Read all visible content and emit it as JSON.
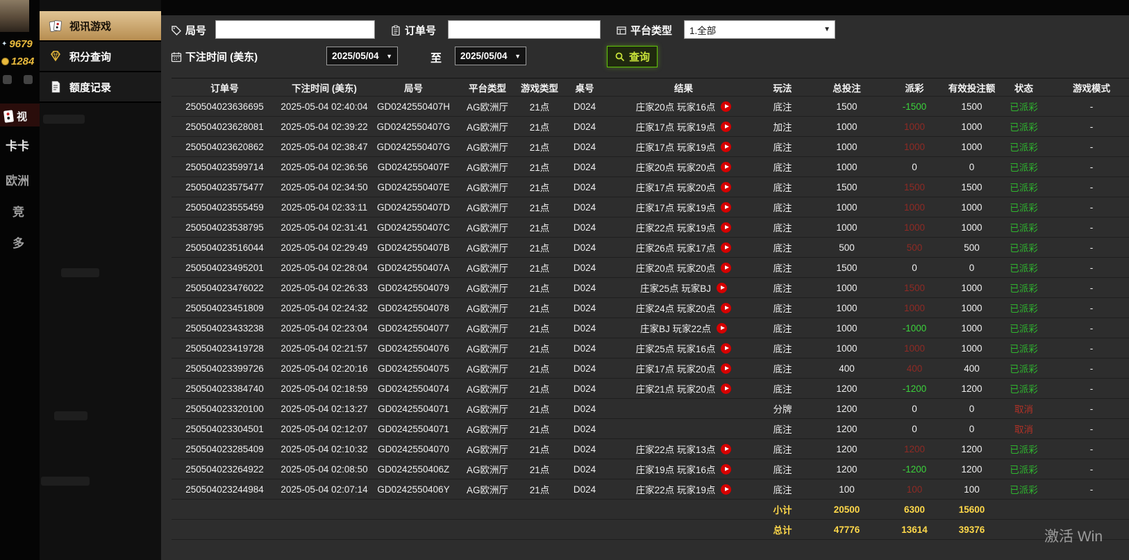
{
  "underlay": {
    "balance_points": "9679",
    "balance_credits": "1284",
    "menu_video": "视",
    "menu_kaka": "卡卡",
    "menu_europe": "欧洲",
    "menu_jing": "竞",
    "menu_duo": "多"
  },
  "sidebar": {
    "items": [
      {
        "label": "视讯游戏"
      },
      {
        "label": "积分查询"
      },
      {
        "label": "额度记录"
      }
    ]
  },
  "filters": {
    "round_label": "局号",
    "round_value": "",
    "order_label": "订单号",
    "order_value": "",
    "platform_label": "平台类型",
    "platform_value": "1.全部",
    "bet_time_label": "下注时间 (美东)",
    "date_from": "2025/05/04",
    "to_label": "至",
    "date_to": "2025/05/04",
    "search_label": "查询"
  },
  "table": {
    "headers": [
      "订单号",
      "下注时间 (美东)",
      "局号",
      "平台类型",
      "游戏类型",
      "桌号",
      "结果",
      "玩法",
      "总投注",
      "派彩",
      "有效投注额",
      "状态",
      "游戏模式"
    ],
    "rows": [
      {
        "order": "250504023636695",
        "time": "2025-05-04 02:40:04",
        "round": "GD0242550407H",
        "platform": "AG欧洲厅",
        "game": "21点",
        "table_no": "D024",
        "result": "庄家20点 玩家16点",
        "has_play": true,
        "play": "底注",
        "bet": "1500",
        "payout": "-1500",
        "payout_type": "neg",
        "valid": "1500",
        "status": "已派彩",
        "status_type": "paid",
        "mode": "-"
      },
      {
        "order": "250504023628081",
        "time": "2025-05-04 02:39:22",
        "round": "GD0242550407G",
        "platform": "AG欧洲厅",
        "game": "21点",
        "table_no": "D024",
        "result": "庄家17点 玩家19点",
        "has_play": true,
        "play": "加注",
        "bet": "1000",
        "payout": "1000",
        "payout_type": "pos",
        "valid": "1000",
        "status": "已派彩",
        "status_type": "paid",
        "mode": "-"
      },
      {
        "order": "250504023620862",
        "time": "2025-05-04 02:38:47",
        "round": "GD0242550407G",
        "platform": "AG欧洲厅",
        "game": "21点",
        "table_no": "D024",
        "result": "庄家17点 玩家19点",
        "has_play": true,
        "play": "底注",
        "bet": "1000",
        "payout": "1000",
        "payout_type": "pos",
        "valid": "1000",
        "status": "已派彩",
        "status_type": "paid",
        "mode": "-"
      },
      {
        "order": "250504023599714",
        "time": "2025-05-04 02:36:56",
        "round": "GD0242550407F",
        "platform": "AG欧洲厅",
        "game": "21点",
        "table_no": "D024",
        "result": "庄家20点 玩家20点",
        "has_play": true,
        "play": "底注",
        "bet": "1000",
        "payout": "0",
        "payout_type": "zero",
        "valid": "0",
        "status": "已派彩",
        "status_type": "paid",
        "mode": "-"
      },
      {
        "order": "250504023575477",
        "time": "2025-05-04 02:34:50",
        "round": "GD0242550407E",
        "platform": "AG欧洲厅",
        "game": "21点",
        "table_no": "D024",
        "result": "庄家17点 玩家20点",
        "has_play": true,
        "play": "底注",
        "bet": "1500",
        "payout": "1500",
        "payout_type": "pos",
        "valid": "1500",
        "status": "已派彩",
        "status_type": "paid",
        "mode": "-"
      },
      {
        "order": "250504023555459",
        "time": "2025-05-04 02:33:11",
        "round": "GD0242550407D",
        "platform": "AG欧洲厅",
        "game": "21点",
        "table_no": "D024",
        "result": "庄家17点 玩家19点",
        "has_play": true,
        "play": "底注",
        "bet": "1000",
        "payout": "1000",
        "payout_type": "pos",
        "valid": "1000",
        "status": "已派彩",
        "status_type": "paid",
        "mode": "-"
      },
      {
        "order": "250504023538795",
        "time": "2025-05-04 02:31:41",
        "round": "GD0242550407C",
        "platform": "AG欧洲厅",
        "game": "21点",
        "table_no": "D024",
        "result": "庄家22点 玩家19点",
        "has_play": true,
        "play": "底注",
        "bet": "1000",
        "payout": "1000",
        "payout_type": "pos",
        "valid": "1000",
        "status": "已派彩",
        "status_type": "paid",
        "mode": "-"
      },
      {
        "order": "250504023516044",
        "time": "2025-05-04 02:29:49",
        "round": "GD0242550407B",
        "platform": "AG欧洲厅",
        "game": "21点",
        "table_no": "D024",
        "result": "庄家26点 玩家17点",
        "has_play": true,
        "play": "底注",
        "bet": "500",
        "payout": "500",
        "payout_type": "pos",
        "valid": "500",
        "status": "已派彩",
        "status_type": "paid",
        "mode": "-"
      },
      {
        "order": "250504023495201",
        "time": "2025-05-04 02:28:04",
        "round": "GD0242550407A",
        "platform": "AG欧洲厅",
        "game": "21点",
        "table_no": "D024",
        "result": "庄家20点 玩家20点",
        "has_play": true,
        "play": "底注",
        "bet": "1500",
        "payout": "0",
        "payout_type": "zero",
        "valid": "0",
        "status": "已派彩",
        "status_type": "paid",
        "mode": "-"
      },
      {
        "order": "250504023476022",
        "time": "2025-05-04 02:26:33",
        "round": "GD02425504079",
        "platform": "AG欧洲厅",
        "game": "21点",
        "table_no": "D024",
        "result": "庄家25点 玩家BJ",
        "has_play": true,
        "play": "底注",
        "bet": "1000",
        "payout": "1500",
        "payout_type": "pos",
        "valid": "1000",
        "status": "已派彩",
        "status_type": "paid",
        "mode": "-"
      },
      {
        "order": "250504023451809",
        "time": "2025-05-04 02:24:32",
        "round": "GD02425504078",
        "platform": "AG欧洲厅",
        "game": "21点",
        "table_no": "D024",
        "result": "庄家24点 玩家20点",
        "has_play": true,
        "play": "底注",
        "bet": "1000",
        "payout": "1000",
        "payout_type": "pos",
        "valid": "1000",
        "status": "已派彩",
        "status_type": "paid",
        "mode": "-"
      },
      {
        "order": "250504023433238",
        "time": "2025-05-04 02:23:04",
        "round": "GD02425504077",
        "platform": "AG欧洲厅",
        "game": "21点",
        "table_no": "D024",
        "result": "庄家BJ 玩家22点",
        "has_play": true,
        "play": "底注",
        "bet": "1000",
        "payout": "-1000",
        "payout_type": "neg",
        "valid": "1000",
        "status": "已派彩",
        "status_type": "paid",
        "mode": "-"
      },
      {
        "order": "250504023419728",
        "time": "2025-05-04 02:21:57",
        "round": "GD02425504076",
        "platform": "AG欧洲厅",
        "game": "21点",
        "table_no": "D024",
        "result": "庄家25点 玩家16点",
        "has_play": true,
        "play": "底注",
        "bet": "1000",
        "payout": "1000",
        "payout_type": "pos",
        "valid": "1000",
        "status": "已派彩",
        "status_type": "paid",
        "mode": "-"
      },
      {
        "order": "250504023399726",
        "time": "2025-05-04 02:20:16",
        "round": "GD02425504075",
        "platform": "AG欧洲厅",
        "game": "21点",
        "table_no": "D024",
        "result": "庄家17点 玩家20点",
        "has_play": true,
        "play": "底注",
        "bet": "400",
        "payout": "400",
        "payout_type": "pos",
        "valid": "400",
        "status": "已派彩",
        "status_type": "paid",
        "mode": "-"
      },
      {
        "order": "250504023384740",
        "time": "2025-05-04 02:18:59",
        "round": "GD02425504074",
        "platform": "AG欧洲厅",
        "game": "21点",
        "table_no": "D024",
        "result": "庄家21点 玩家20点",
        "has_play": true,
        "play": "底注",
        "bet": "1200",
        "payout": "-1200",
        "payout_type": "neg",
        "valid": "1200",
        "status": "已派彩",
        "status_type": "paid",
        "mode": "-"
      },
      {
        "order": "250504023320100",
        "time": "2025-05-04 02:13:27",
        "round": "GD02425504071",
        "platform": "AG欧洲厅",
        "game": "21点",
        "table_no": "D024",
        "result": "",
        "has_play": false,
        "play": "分牌",
        "bet": "1200",
        "payout": "0",
        "payout_type": "zero",
        "valid": "0",
        "status": "取消",
        "status_type": "cancel",
        "mode": "-"
      },
      {
        "order": "250504023304501",
        "time": "2025-05-04 02:12:07",
        "round": "GD02425504071",
        "platform": "AG欧洲厅",
        "game": "21点",
        "table_no": "D024",
        "result": "",
        "has_play": false,
        "play": "底注",
        "bet": "1200",
        "payout": "0",
        "payout_type": "zero",
        "valid": "0",
        "status": "取消",
        "status_type": "cancel",
        "mode": "-"
      },
      {
        "order": "250504023285409",
        "time": "2025-05-04 02:10:32",
        "round": "GD02425504070",
        "platform": "AG欧洲厅",
        "game": "21点",
        "table_no": "D024",
        "result": "庄家22点 玩家13点",
        "has_play": true,
        "play": "底注",
        "bet": "1200",
        "payout": "1200",
        "payout_type": "pos",
        "valid": "1200",
        "status": "已派彩",
        "status_type": "paid",
        "mode": "-"
      },
      {
        "order": "250504023264922",
        "time": "2025-05-04 02:08:50",
        "round": "GD0242550406Z",
        "platform": "AG欧洲厅",
        "game": "21点",
        "table_no": "D024",
        "result": "庄家19点 玩家16点",
        "has_play": true,
        "play": "底注",
        "bet": "1200",
        "payout": "-1200",
        "payout_type": "neg",
        "valid": "1200",
        "status": "已派彩",
        "status_type": "paid",
        "mode": "-"
      },
      {
        "order": "250504023244984",
        "time": "2025-05-04 02:07:14",
        "round": "GD0242550406Y",
        "platform": "AG欧洲厅",
        "game": "21点",
        "table_no": "D024",
        "result": "庄家22点 玩家19点",
        "has_play": true,
        "play": "底注",
        "bet": "100",
        "payout": "100",
        "payout_type": "pos",
        "valid": "100",
        "status": "已派彩",
        "status_type": "paid",
        "mode": "-"
      }
    ],
    "subtotal": {
      "label": "小计",
      "total_bet": "20500",
      "payout": "6300",
      "valid_bet": "15600"
    },
    "grand_total": {
      "label": "总计",
      "total_bet": "47776",
      "payout": "13614",
      "valid_bet": "39376"
    }
  },
  "watermark": "激活 Win"
}
